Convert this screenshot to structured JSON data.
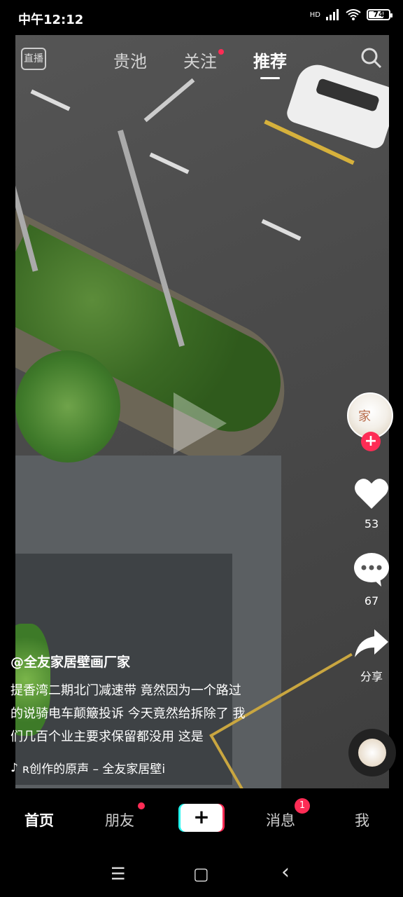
{
  "status_bar": {
    "time": "中午12:12",
    "signal": "HD",
    "battery": "74",
    "battery_level": 0.74
  },
  "top_nav": {
    "live_label": "直播",
    "tabs": [
      {
        "label": "贵池"
      },
      {
        "label": "关注"
      },
      {
        "label": "推荐"
      }
    ]
  },
  "rail": {
    "avatar_glyph": "家",
    "follow_label": "+",
    "likes": "53",
    "comments": "67",
    "share_label": "分享"
  },
  "caption": {
    "author": "@全友家居壁画厂家",
    "line1": "提香湾二期北门减速带 竟然因为一个路过",
    "line2": "的说骑电车颠簸投诉 今天竟然给拆除了 我",
    "line3": "们几百个业主要求保留都没用 这是",
    "music": "ʀ创作的原声 – 全友家居壁i"
  },
  "bottom_nav": {
    "home": "首页",
    "friends": "朋友",
    "create": "+",
    "messages": "消息",
    "messages_badge": "1",
    "me": "我"
  },
  "system_nav": {
    "menu": "☰",
    "home": "▢",
    "back": "‹"
  },
  "colors": {
    "accent": "#fe2c55",
    "cyan": "#25f4ee"
  }
}
